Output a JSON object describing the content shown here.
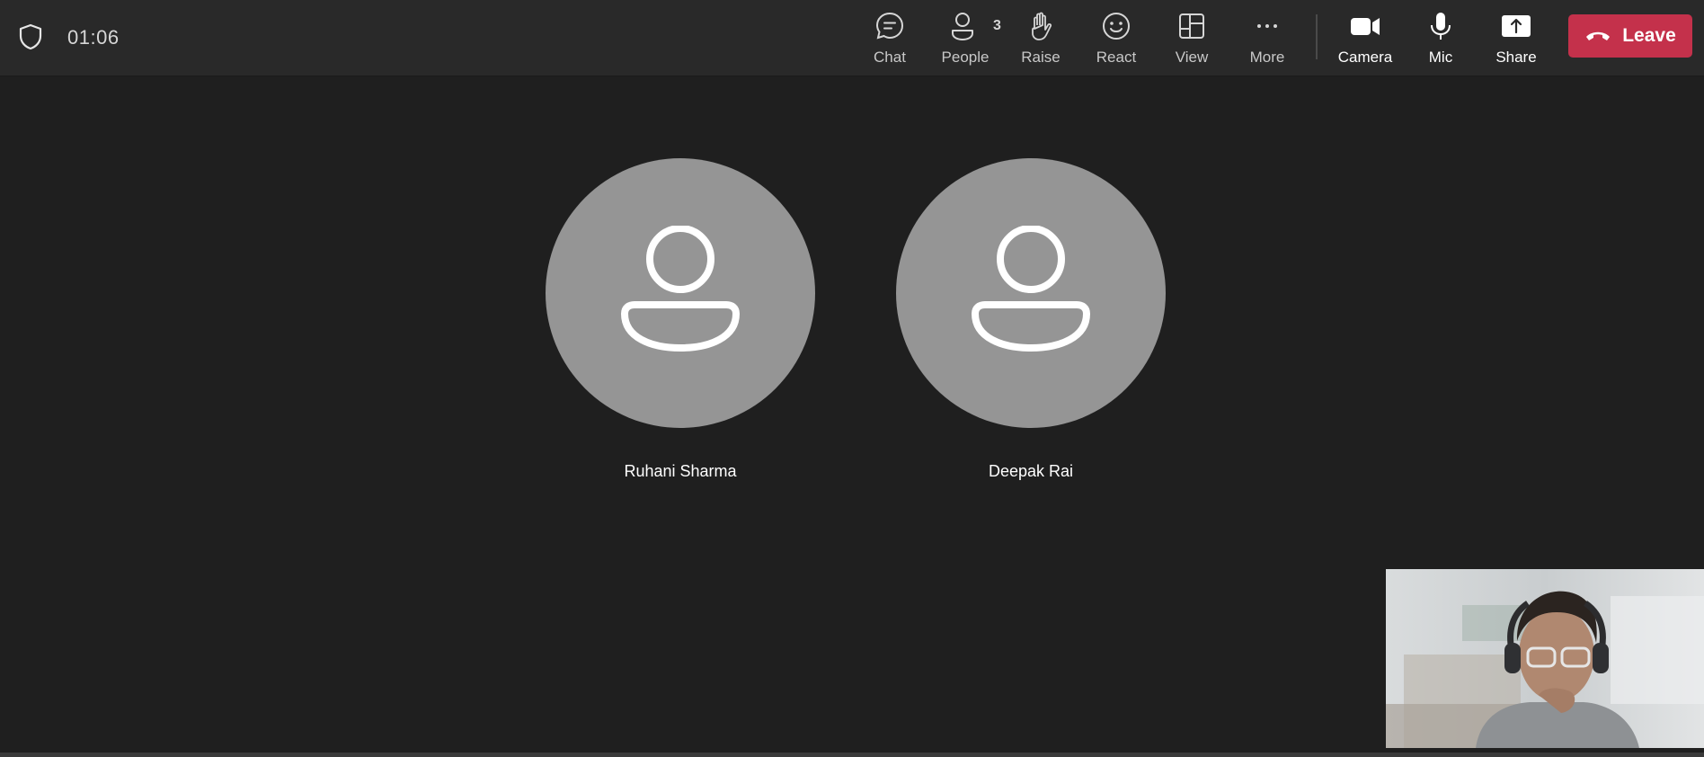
{
  "header": {
    "timer": "01:06",
    "security_icon": "shield-icon"
  },
  "toolbar": {
    "chat": {
      "label": "Chat",
      "icon": "chat-icon"
    },
    "people": {
      "label": "People",
      "icon": "people-icon",
      "count": "3"
    },
    "raise": {
      "label": "Raise",
      "icon": "hand-icon"
    },
    "react": {
      "label": "React",
      "icon": "smiley-icon"
    },
    "view": {
      "label": "View",
      "icon": "layout-icon"
    },
    "more": {
      "label": "More",
      "icon": "ellipsis-icon"
    },
    "camera": {
      "label": "Camera",
      "icon": "camera-icon"
    },
    "mic": {
      "label": "Mic",
      "icon": "mic-icon"
    },
    "share": {
      "label": "Share",
      "icon": "share-tray-icon"
    },
    "leave": {
      "label": "Leave",
      "icon": "hangup-icon",
      "color": "#c4314b"
    }
  },
  "participants": [
    {
      "name": "Ruhani Sharma",
      "avatar_icon": "person-icon"
    },
    {
      "name": "Deepak Rai",
      "avatar_icon": "person-icon"
    }
  ],
  "colors": {
    "background": "#1f1f1f",
    "toolbar": "#292929",
    "avatar": "#959595",
    "leave": "#c4314b"
  }
}
